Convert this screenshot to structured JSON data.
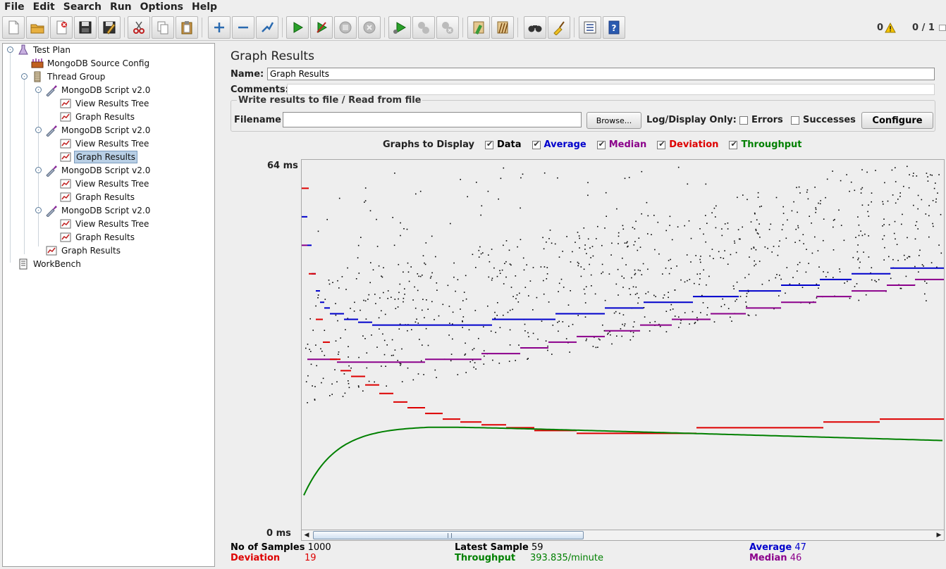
{
  "menu": [
    {
      "label": "File",
      "key": "F",
      "rest": "ile"
    },
    {
      "label": "Edit",
      "key": "E",
      "rest": "dit"
    },
    {
      "label": "Search",
      "key": "",
      "rest": "Search"
    },
    {
      "label": "Run",
      "key": "R",
      "rest": "un"
    },
    {
      "label": "Options",
      "key": "O",
      "rest": "ptions"
    },
    {
      "label": "Help",
      "key": "H",
      "rest": "elp"
    }
  ],
  "toolbar": {
    "buttons": [
      "new-icon",
      "open-icon",
      "close-file-icon",
      "save-icon",
      "save-as-icon",
      "cut-icon",
      "copy-icon",
      "paste-icon",
      "expand-icon",
      "collapse-icon",
      "toggle-icon",
      "start-icon",
      "start-no-pause-icon",
      "stop-icon",
      "shutdown-icon",
      "remote-start-icon",
      "remote-stop-icon",
      "remote-shutdown-icon",
      "clear-icon",
      "clear-all-icon",
      "search-icon",
      "reset-search-icon",
      "function-helper-icon",
      "help-icon"
    ],
    "error_count": "0",
    "threads": "0 / 1"
  },
  "tree": {
    "nodes": [
      {
        "label": "Test Plan",
        "icon": "test-plan-icon"
      },
      {
        "label": "MongoDB Source Config",
        "icon": "config-icon"
      },
      {
        "label": "Thread Group",
        "icon": "thread-group-icon"
      },
      {
        "label": "MongoDB Script v2.0",
        "icon": "sampler-icon"
      },
      {
        "label": "View Results Tree",
        "icon": "listener-icon"
      },
      {
        "label": "Graph Results",
        "icon": "listener-icon"
      },
      {
        "label": "MongoDB Script v2.0",
        "icon": "sampler-icon"
      },
      {
        "label": "View Results Tree",
        "icon": "listener-icon"
      },
      {
        "label": "Graph Results",
        "icon": "listener-icon"
      },
      {
        "label": "MongoDB Script v2.0",
        "icon": "sampler-icon"
      },
      {
        "label": "View Results Tree",
        "icon": "listener-icon"
      },
      {
        "label": "Graph Results",
        "icon": "listener-icon"
      },
      {
        "label": "MongoDB Script v2.0",
        "icon": "sampler-icon"
      },
      {
        "label": "View Results Tree",
        "icon": "listener-icon"
      },
      {
        "label": "Graph Results",
        "icon": "listener-icon"
      },
      {
        "label": "Graph Results",
        "icon": "listener-icon"
      },
      {
        "label": "WorkBench",
        "icon": "workbench-icon"
      }
    ],
    "selected_index": 8
  },
  "panel": {
    "title": "Graph Results",
    "name_label": "Name:",
    "name_value": "Graph Results",
    "comments_label": "Comments:",
    "comments_value": "",
    "file_legend": "Write results to file / Read from file",
    "filename_label": "Filename",
    "filename_value": "",
    "browse_label": "Browse...",
    "log_display_label": "Log/Display Only:",
    "errors_label": "Errors",
    "successes_label": "Successes",
    "configure_label": "Configure"
  },
  "graphs_to_display": {
    "label": "Graphs to Display",
    "options": [
      {
        "label": "Data",
        "checked": true,
        "color": "#000000"
      },
      {
        "label": "Average",
        "checked": true,
        "color": "#0000cc"
      },
      {
        "label": "Median",
        "checked": true,
        "color": "#8b008b"
      },
      {
        "label": "Deviation",
        "checked": true,
        "color": "#dd0000"
      },
      {
        "label": "Throughput",
        "checked": true,
        "color": "#008000"
      }
    ]
  },
  "graph": {
    "y_max_label": "64 ms",
    "y_min_label": "0 ms"
  },
  "stats": {
    "samples_label": "No of Samples",
    "samples_value": "1000",
    "deviation_label": "Deviation",
    "deviation_value": "19",
    "latest_label": "Latest Sample",
    "latest_value": "59",
    "throughput_label": "Throughput",
    "throughput_value": "393.835/minute",
    "average_label": "Average",
    "average_value": "47",
    "median_label": "Median",
    "median_value": "46"
  },
  "colors": {
    "data": "#000000",
    "average": "#0000cc",
    "median": "#8b008b",
    "deviation": "#dd0000",
    "throughput": "#008000"
  }
}
